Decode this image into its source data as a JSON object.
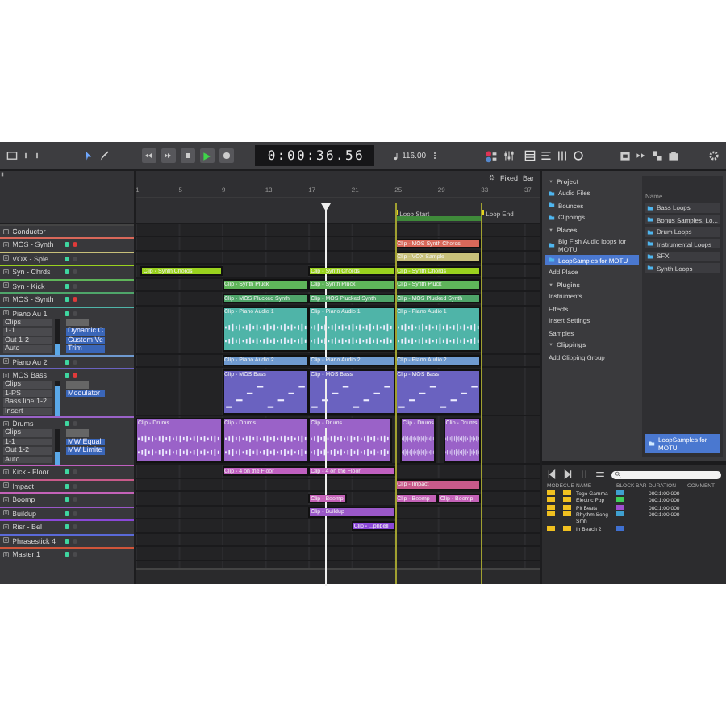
{
  "toolbar": {
    "time": "0:00:36.56",
    "tempo": "116.00"
  },
  "arrange": {
    "grid_mode": "Fixed",
    "grid_unit": "Bar",
    "ruler": [
      "1",
      "5",
      "9",
      "13",
      "17",
      "21",
      "25",
      "29",
      "33",
      "37"
    ],
    "loop": {
      "start_label": "Loop Start",
      "end_label": "Loop End"
    }
  },
  "conductor": {
    "name": "Conductor"
  },
  "tracks": [
    {
      "name": "MOS - Synth",
      "color": "#d9685a",
      "kind": "small",
      "armed": true,
      "clips": [
        {
          "label": "Clip - MOS Synth Chords"
        }
      ]
    },
    {
      "name": "VOX - Sple",
      "color": "#c8c07a",
      "kind": "small",
      "armed": false,
      "clips": [
        {
          "label": "Clip - VOX Sample"
        }
      ]
    },
    {
      "name": "Syn - Chrds",
      "color": "#9ad21e",
      "kind": "small",
      "armed": false,
      "clips": [
        {
          "label": "Clip - Synth Chords"
        },
        {
          "label": "Clip - Synth Chords"
        },
        {
          "label": "Clip - Synth Chords"
        }
      ]
    },
    {
      "name": "Syn - Kick",
      "color": "#5fb55a",
      "kind": "small",
      "armed": false,
      "clips": [
        {
          "label": "Clip - Synth Pluck"
        },
        {
          "label": "Clip - Synth Pluck"
        },
        {
          "label": "Clip - Synth Pluck"
        }
      ]
    },
    {
      "name": "MOS - Synth",
      "color": "#4fa56a",
      "kind": "small",
      "armed": true,
      "clips": [
        {
          "label": "Clip - MOS Plucked Synth"
        },
        {
          "label": "Clip - MOS Plucked Synth"
        },
        {
          "label": "Clip - MOS Plucked Synth"
        }
      ]
    },
    {
      "name": "Piano Au 1",
      "color": "#4fb4a8",
      "kind": "audio",
      "armed": false,
      "level": 0.3,
      "fields": [
        "Clips",
        "1-1",
        "Out 1-2",
        "Auto"
      ],
      "plugins": [
        "Dynamic C",
        "Custom Ve",
        "Trim"
      ],
      "clips": [
        {
          "label": "Clip - Piano Audio 1"
        },
        {
          "label": "Clip - Piano Audio 1"
        },
        {
          "label": "Clip - Piano Audio 1"
        }
      ]
    },
    {
      "name": "Piano Au 2",
      "color": "#6f9ad0",
      "kind": "small",
      "armed": false,
      "clips": [
        {
          "label": "Clip - Piano Audio 2"
        },
        {
          "label": "Clip - Piano Audio 2"
        },
        {
          "label": "Clip - Piano Audio 2"
        }
      ]
    },
    {
      "name": "MOS Bass",
      "color": "#6a62c0",
      "kind": "midi",
      "armed": true,
      "level": 0.85,
      "fields": [
        "Clips",
        "1-PS",
        "Bass line 1-2",
        "Insert"
      ],
      "plugins": [
        "Modulator"
      ],
      "clips": [
        {
          "label": "Clip - MOS Bass"
        },
        {
          "label": "Clip - MOS Bass"
        },
        {
          "label": "Clip - MOS Bass"
        }
      ]
    },
    {
      "name": "Drums",
      "color": "#9a62c8",
      "kind": "audio",
      "armed": false,
      "level": 0.35,
      "fields": [
        "Clips",
        "1-1",
        "Out 1-2",
        "Auto"
      ],
      "plugins": [
        "MW Equali",
        "MW Limite"
      ],
      "clips": [
        {
          "label": "Clip - Drums"
        },
        {
          "label": "Clip - Drums"
        },
        {
          "label": "Clip - Drums"
        },
        {
          "label": "Clip - Drums"
        },
        {
          "label": "Clip - Drums"
        }
      ]
    },
    {
      "name": "Kick - Floor",
      "color": "#c060c0",
      "kind": "small",
      "armed": false,
      "clips": [
        {
          "label": "Clip - 4 on the Floor"
        },
        {
          "label": "Clip - 4 on the Floor"
        }
      ]
    },
    {
      "name": "Impact",
      "color": "#c85a8a",
      "kind": "small",
      "armed": false,
      "clips": [
        {
          "label": "Clip - Impact"
        }
      ]
    },
    {
      "name": "Boomp",
      "color": "#c462b8",
      "kind": "small",
      "armed": false,
      "clips": [
        {
          "label": "Clip - Boomp"
        },
        {
          "label": "Clip - Boomp"
        },
        {
          "label": "Clip - Boomp"
        }
      ]
    },
    {
      "name": "Buildup",
      "color": "#9a58c8",
      "kind": "small",
      "armed": false,
      "clips": [
        {
          "label": "Clip - Buildup"
        }
      ]
    },
    {
      "name": "Risr - Bel",
      "color": "#8a48d8",
      "kind": "small",
      "armed": false,
      "clips": [
        {
          "label": "Clip - ...phbell"
        }
      ]
    },
    {
      "name": "Phrasestick 4",
      "color": "#5a6ad8",
      "kind": "small",
      "armed": false
    },
    {
      "name": "Master 1",
      "color": "#d0553a",
      "kind": "small",
      "armed": false
    }
  ],
  "browser": {
    "items": [
      {
        "kind": "header",
        "label": "Project"
      },
      {
        "kind": "folder",
        "label": "Audio Files",
        "selected": false
      },
      {
        "kind": "folder",
        "label": "Bounces",
        "selected": false
      },
      {
        "kind": "folder",
        "label": "Clippings",
        "selected": false
      },
      {
        "kind": "header",
        "label": "Places"
      },
      {
        "kind": "folder",
        "label": "Big Fish Audio loops for MOTU",
        "selected": false
      },
      {
        "kind": "folder",
        "label": "LoopSamples for MOTU",
        "selected": true
      },
      {
        "kind": "add",
        "label": "Add Place"
      },
      {
        "kind": "header",
        "label": "Plugins"
      },
      {
        "kind": "item",
        "label": "Instruments",
        "selected": false
      },
      {
        "kind": "item",
        "label": "Effects",
        "selected": false
      },
      {
        "kind": "item",
        "label": "Insert Settings",
        "selected": false
      },
      {
        "kind": "item",
        "label": "Samples",
        "selected": false
      },
      {
        "kind": "header",
        "label": "Clippings"
      },
      {
        "kind": "add",
        "label": "Add Clipping Group"
      }
    ],
    "files_header": "Name",
    "files": [
      "Bass Loops",
      "Bonus Samples, Lo...",
      "Drum Loops",
      "Instrumental Loops",
      "SFX",
      "Synth Loops"
    ],
    "location_button": "LoopSamples for MOTU"
  },
  "soundbites": {
    "columns": [
      "MODE",
      "CUE",
      "NAME",
      "BLOCK",
      "BAR",
      "DURATION",
      "COMMENT"
    ],
    "rows": [
      {
        "name": "Togo Gamma",
        "color": "#3fa0d0",
        "duration": "000:1:00:000"
      },
      {
        "name": "Electric Pop",
        "color": "#3fd05a",
        "duration": "000:1:00:000"
      },
      {
        "name": "Pit Beats",
        "color": "#a04fd0",
        "duration": "000:1:00:000"
      },
      {
        "name": "Rhythm Song Smh",
        "color": "#3fa0d0",
        "duration": "000:1:00:000"
      },
      {
        "name": "In Beach 2",
        "color": "#3f70d0"
      }
    ]
  }
}
